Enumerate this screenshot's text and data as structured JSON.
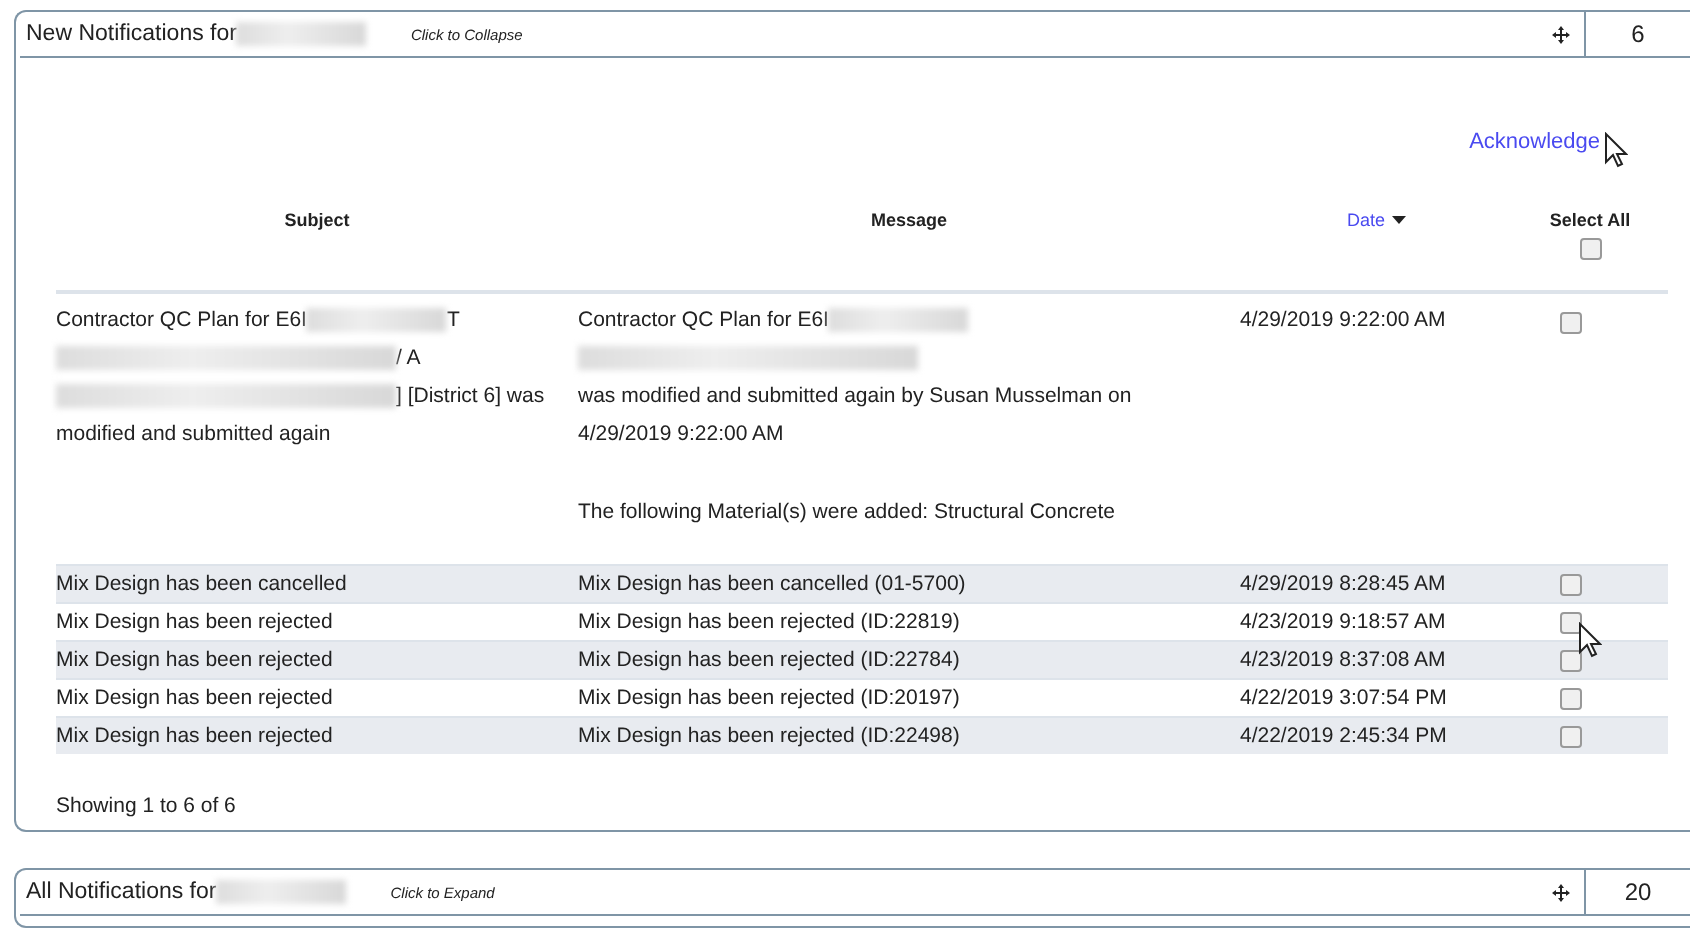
{
  "panels": [
    {
      "title": "New Notifications for",
      "title_redacted": true,
      "toggle": "Click to Collapse",
      "count": "6",
      "expanded": true,
      "acknowledge": "Acknowledge",
      "columns": [
        {
          "label": "Subject",
          "sorted": false
        },
        {
          "label": "Message",
          "sorted": false
        },
        {
          "label": "Date",
          "sorted": true
        },
        {
          "label": "Select All",
          "kind": "select"
        }
      ],
      "select_all_checked": false,
      "rows": [
        {
          "subject": [
            {
              "before": "Contractor QC Plan for E6I",
              "redacted": true,
              "after": "T"
            },
            {
              "redacted": true,
              "after": "/ A"
            },
            {
              "redacted": true,
              "after": "] [District 6] was"
            },
            {
              "before": "modified and submitted again",
              "redacted": false
            }
          ],
          "message": [
            {
              "before": "Contractor QC Plan for E6I",
              "redacted": true
            },
            {
              "redacted": true
            },
            {
              "before": "was modified and submitted again by Susan Musselman on",
              "redacted": false
            },
            {
              "before": "4/29/2019 9:22:00 AM",
              "redacted": false
            }
          ],
          "message_note": "The following Material(s) were added: Structural Concrete",
          "date": "4/29/2019 9:22:00 AM",
          "checked": false
        },
        {
          "subject": [
            {
              "before": "Mix Design has been cancelled",
              "redacted": false
            }
          ],
          "message": [
            {
              "before": "Mix Design has been cancelled (01-5700)",
              "redacted": false
            }
          ],
          "date": "4/29/2019 8:28:45 AM",
          "checked": false
        },
        {
          "subject": [
            {
              "before": "Mix Design has been rejected",
              "redacted": false
            }
          ],
          "message": [
            {
              "before": "Mix Design has been rejected (ID:22819)",
              "redacted": false
            }
          ],
          "date": "4/23/2019 9:18:57 AM",
          "checked": false
        },
        {
          "subject": [
            {
              "before": "Mix Design has been rejected",
              "redacted": false
            }
          ],
          "message": [
            {
              "before": "Mix Design has been rejected (ID:22784)",
              "redacted": false
            }
          ],
          "date": "4/23/2019 8:37:08 AM",
          "checked": false
        },
        {
          "subject": [
            {
              "before": "Mix Design has been rejected",
              "redacted": false
            }
          ],
          "message": [
            {
              "before": "Mix Design has been rejected (ID:20197)",
              "redacted": false
            }
          ],
          "date": "4/22/2019 3:07:54 PM",
          "checked": false
        },
        {
          "subject": [
            {
              "before": "Mix Design has been rejected",
              "redacted": false
            }
          ],
          "message": [
            {
              "before": "Mix Design has been rejected (ID:22498)",
              "redacted": false
            }
          ],
          "date": "4/22/2019 2:45:34 PM",
          "checked": false
        }
      ],
      "footer": "Showing 1 to 6 of 6"
    },
    {
      "title": "All Notifications for",
      "title_redacted": true,
      "toggle": "Click to Expand",
      "count": "20",
      "expanded": false
    }
  ]
}
